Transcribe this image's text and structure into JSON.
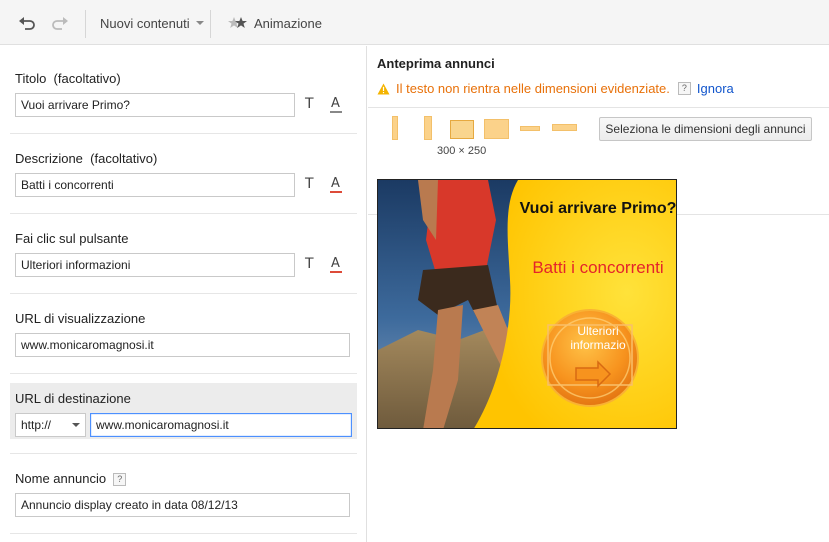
{
  "toolbar": {
    "new_content_label": "Nuovi contenuti",
    "animation_label": "Animazione"
  },
  "form": {
    "title": {
      "label": "Titolo",
      "optional": "(facoltativo)",
      "value": "Vuoi arrivare Primo?"
    },
    "description": {
      "label": "Descrizione",
      "optional": "(facoltativo)",
      "value": "Batti i concorrenti"
    },
    "button": {
      "label": "Fai clic sul pulsante",
      "value": "Ulteriori informazioni"
    },
    "display_url": {
      "label": "URL di visualizzazione",
      "value": "www.monicaromagnosi.it"
    },
    "destination_url": {
      "label": "URL di destinazione",
      "protocol": "http://",
      "value": "www.monicaromagnosi.it"
    },
    "ad_name": {
      "label": "Nome annuncio",
      "help": "?",
      "value": "Annuncio display creato in data 08/12/13"
    },
    "format_text_icon": "T",
    "format_color_icon": "A"
  },
  "preview": {
    "title": "Anteprima annunci",
    "warning": "Il testo non rientra nelle dimensioni evidenziate.",
    "help": "?",
    "ignore_link": "Ignora",
    "selected_size": "300 × 250",
    "select_sizes_button": "Seleziona le dimensioni degli annunci",
    "ad": {
      "headline": "Vuoi arrivare Primo?",
      "description": "Batti i concorrenti",
      "button_text": "Ulteriori informazio"
    }
  },
  "colors": {
    "accent_link": "#1155cc",
    "warning": "#e8710a",
    "ad_description": "#e4242b",
    "ad_background": "#ffd400"
  }
}
